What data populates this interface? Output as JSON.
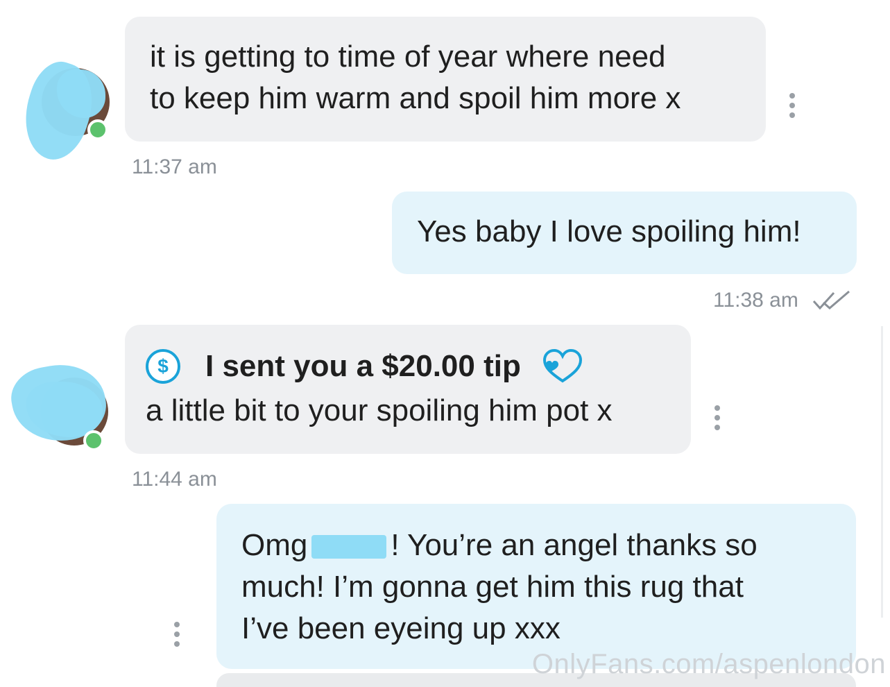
{
  "messages": [
    {
      "direction": "incoming",
      "text": "it is getting to time of year where need\nto keep him warm and spoil him more x",
      "time": "11:37 am"
    },
    {
      "direction": "outgoing",
      "text": "Yes baby I love spoiling him!",
      "time": "11:38 am",
      "status": "read-double-check"
    },
    {
      "direction": "incoming",
      "tip": {
        "icon": "dollar-coin-icon",
        "text": "I sent you a $20.00 tip",
        "reaction_icon": "heart-outline-icon"
      },
      "text": "a little bit to your spoiling him pot x",
      "time": "11:44 am"
    },
    {
      "direction": "outgoing",
      "text_before_censor": "Omg",
      "text_after_censor": "! You’re an angel thanks so",
      "text_rest": "much! I’m gonna get him this rug that\nI’ve been eyeing up xxx"
    }
  ],
  "watermark": "OnlyFans.com/aspenlondon",
  "colors": {
    "incoming_bubble": "#eff0f2",
    "outgoing_bubble": "#e4f4fb",
    "accent": "#1aa3d9",
    "online": "#5cc26d",
    "censor": "#8fdcf6"
  }
}
